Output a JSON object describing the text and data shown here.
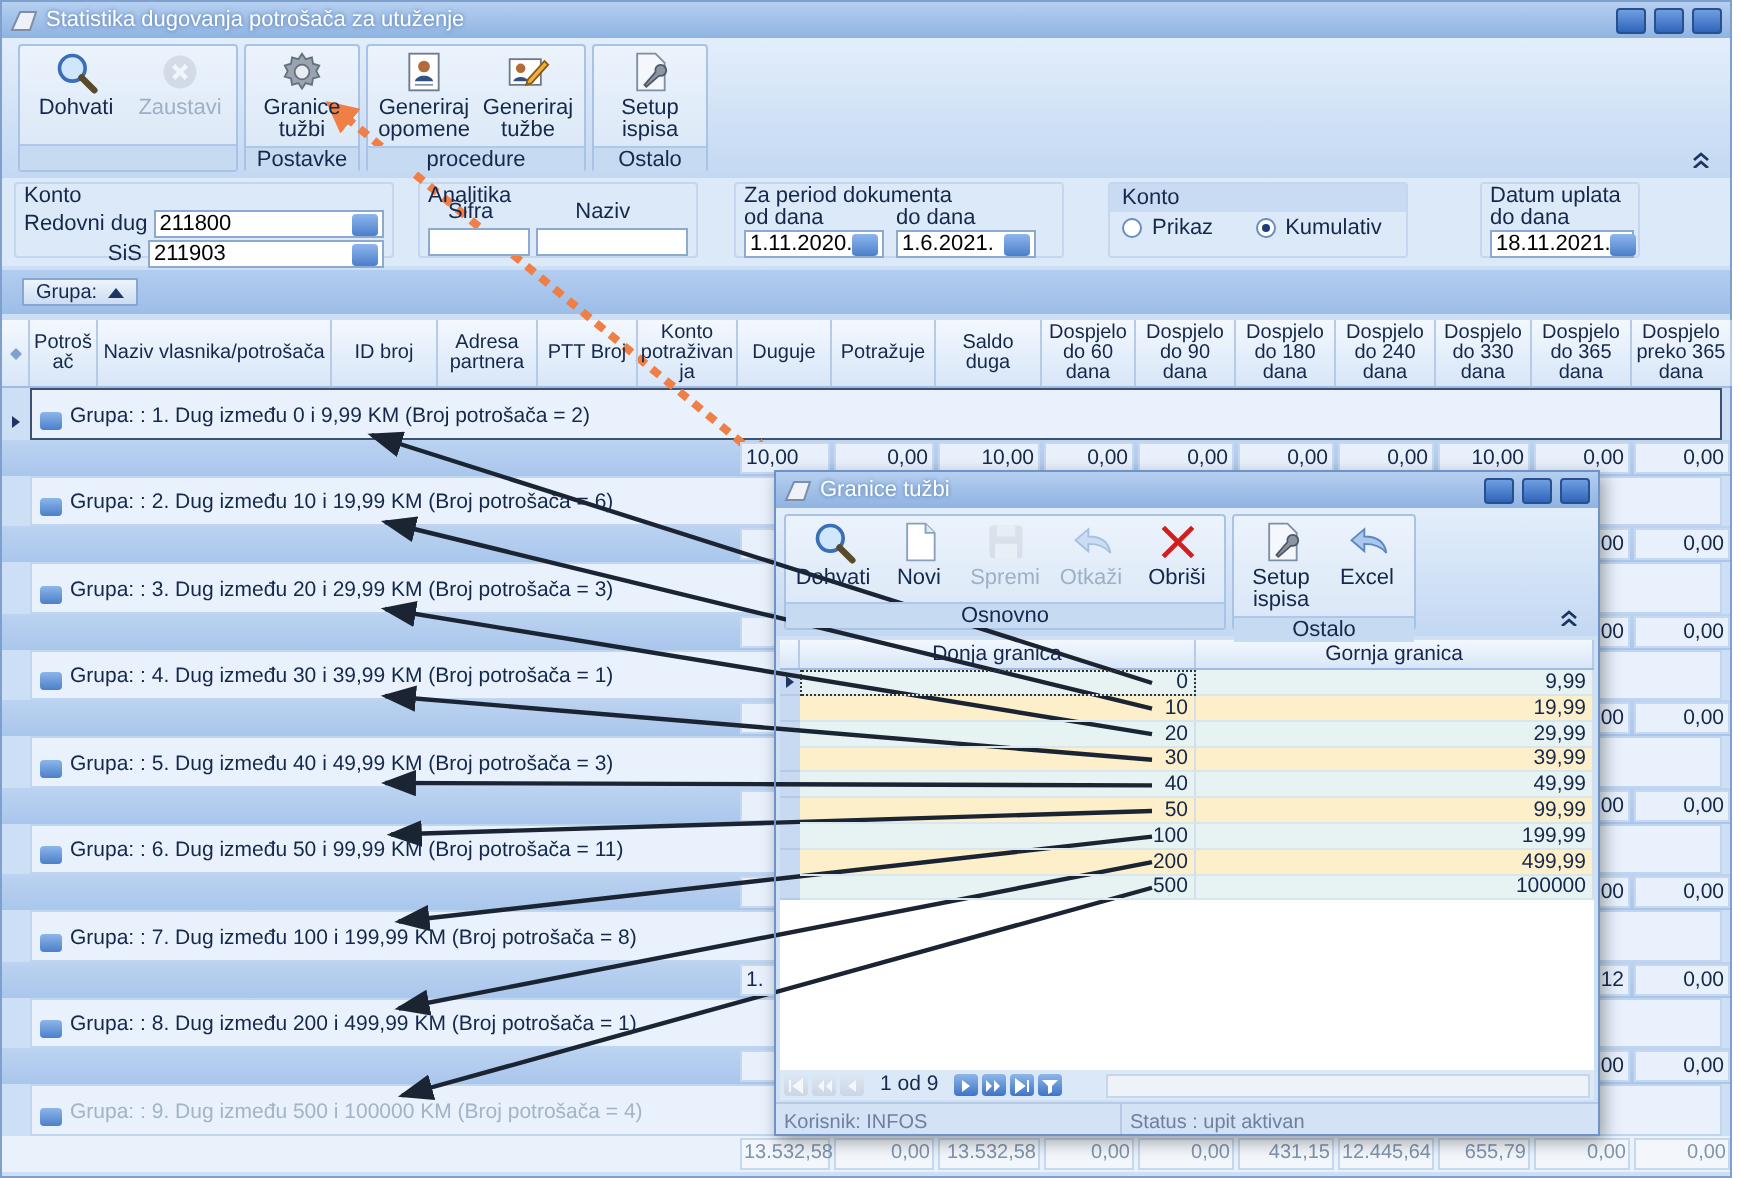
{
  "window": {
    "title": "Statistika dugovanja potrošača za utuženje"
  },
  "ribbon": {
    "groups": [
      {
        "buttons": [
          {
            "label": "Dohvati",
            "kind": "search",
            "disabled": false
          },
          {
            "label": "Zaustavi",
            "kind": "stop",
            "disabled": true
          }
        ]
      },
      {
        "label": "Postavke",
        "buttons": [
          {
            "label": "Granice tužbi",
            "kind": "gear",
            "disabled": false,
            "callout": true
          }
        ]
      },
      {
        "label": "procedure",
        "buttons": [
          {
            "label": "Generiraj opomene",
            "kind": "card",
            "disabled": false
          },
          {
            "label": "Generiraj tužbe",
            "kind": "cardpen",
            "disabled": false
          }
        ]
      },
      {
        "label": "Ostalo",
        "buttons": [
          {
            "label": "Setup ispisa",
            "kind": "setup",
            "disabled": false
          }
        ]
      }
    ]
  },
  "filters": {
    "konto": {
      "title": "Konto",
      "fields": [
        {
          "label": "Redovni dug",
          "value": "211800"
        },
        {
          "label": "SiS",
          "value": "211903"
        }
      ]
    },
    "analitika": {
      "title": "Analitika",
      "columns": [
        "Šifra",
        "Naziv"
      ]
    },
    "period": {
      "title": "Za period dokumenta",
      "fields": [
        {
          "label": "od dana",
          "value": "1.11.2020."
        },
        {
          "label": "do dana",
          "value": "1.6.2021."
        }
      ]
    },
    "konto_view": {
      "title": "Konto",
      "options": [
        {
          "label": "Prikaz",
          "selected": false
        },
        {
          "label": "Kumulativ",
          "selected": true
        }
      ]
    },
    "uplata": {
      "title": "Datum uplata",
      "fields": [
        {
          "label": "do dana",
          "value": "18.11.2021."
        }
      ]
    }
  },
  "group_bar": {
    "label": "Grupa:"
  },
  "grid": {
    "columns": [
      "Potrošač",
      "Naziv vlasnika/potrošača",
      "ID broj",
      "Adresa partnera",
      "PTT Broj",
      "Konto potraživanja",
      "Duguje",
      "Potražuje",
      "Saldo duga",
      "Dospjelo do 60 dana",
      "Dospjelo do 90 dana",
      "Dospjelo do 180 dana",
      "Dospjelo do 240 dana",
      "Dospjelo do 330 dana",
      "Dospjelo do 365 dana",
      "Dospjelo preko 365 dana"
    ],
    "groups": [
      {
        "label": "Grupa: : 1. Dug između 0 i 9,99 KM (Broj potrošača = 2)",
        "current": true,
        "summary": {
          "duguje": "10,00",
          "potrazuje": "0,00",
          "saldo": "10,00",
          "do_60": "0,00",
          "do_90": "0,00",
          "do_180": "0,00",
          "do_240": "0,00",
          "do_330": "10,00",
          "do_365": "0,00",
          "preko_365": "0,00"
        }
      },
      {
        "label": "Grupa: : 2. Dug između 10 i 19,99 KM (Broj potrošača = 6)",
        "current": false,
        "summary": {
          "do_365": "00",
          "preko_365": "0,00"
        }
      },
      {
        "label": "Grupa: : 3. Dug između 20 i 29,99 KM (Broj potrošača = 3)",
        "current": false,
        "summary": {
          "do_365": "00",
          "preko_365": "0,00"
        }
      },
      {
        "label": "Grupa: : 4. Dug između 30 i 39,99 KM (Broj potrošača = 1)",
        "current": false,
        "summary": {
          "do_365": "00",
          "preko_365": "0,00"
        }
      },
      {
        "label": "Grupa: : 5. Dug između 40 i 49,99 KM (Broj potrošača = 3)",
        "current": false,
        "summary": {
          "do_365": "00",
          "preko_365": "0,00"
        }
      },
      {
        "label": "Grupa: : 6. Dug između 50 i 99,99 KM (Broj potrošača = 11)",
        "current": false,
        "summary": {
          "do_365": "00",
          "preko_365": "0,00"
        }
      },
      {
        "label": "Grupa: : 7. Dug između 100 i 199,99 KM (Broj potrošača = 8)",
        "current": false,
        "summary": {
          "duguje": "1.",
          "do_365": "12",
          "preko_365": "0,00"
        }
      },
      {
        "label": "Grupa: : 8. Dug između 200 i 499,99 KM (Broj potrošača = 1)",
        "current": false,
        "summary": {
          "do_365": "00",
          "preko_365": "0,00"
        }
      },
      {
        "label": "Grupa: : 9. Dug između 500 i 100000 KM (Broj potrošača = 4)",
        "current": false
      }
    ],
    "totals": [
      "13.532,58",
      "0,00",
      "13.532,58",
      "0,00",
      "0,00",
      "431,15",
      "12.445,64",
      "655,79",
      "0,00",
      "0,00"
    ]
  },
  "dialog": {
    "title": "Granice tužbi",
    "ribbon": {
      "groups": [
        {
          "label": "Osnovno",
          "buttons": [
            {
              "label": "Dohvati",
              "kind": "search",
              "disabled": false
            },
            {
              "label": "Novi",
              "kind": "doc",
              "disabled": false
            },
            {
              "label": "Spremi",
              "kind": "floppy",
              "disabled": true
            },
            {
              "label": "Otkaži",
              "kind": "undo",
              "disabled": true
            },
            {
              "label": "Obriši",
              "kind": "delete",
              "disabled": false
            }
          ]
        },
        {
          "label": "Ostalo",
          "buttons": [
            {
              "label": "Setup ispisa",
              "kind": "setup",
              "disabled": false
            },
            {
              "label": "Excel",
              "kind": "undo",
              "disabled": false
            }
          ]
        }
      ]
    },
    "columns": [
      "Donja granica",
      "Gornja granica"
    ],
    "rows": [
      {
        "lower": "0",
        "upper": "9,99",
        "current": true,
        "arrow": true
      },
      {
        "lower": "10",
        "upper": "19,99",
        "current": false,
        "arrow": true
      },
      {
        "lower": "20",
        "upper": "29,99",
        "current": false,
        "arrow": true
      },
      {
        "lower": "30",
        "upper": "39,99",
        "current": false,
        "arrow": true
      },
      {
        "lower": "40",
        "upper": "49,99",
        "current": false,
        "arrow": true
      },
      {
        "lower": "50",
        "upper": "99,99",
        "current": false,
        "arrow": true
      },
      {
        "lower": "100",
        "upper": "199,99",
        "current": false,
        "arrow": true
      },
      {
        "lower": "200",
        "upper": "499,99",
        "current": false,
        "arrow": true
      },
      {
        "lower": "500",
        "upper": "100000",
        "current": false,
        "arrow": true
      }
    ],
    "pager": {
      "text": "1 od 9",
      "buttons": [
        {
          "kind": "first",
          "disabled": true
        },
        {
          "kind": "prevpage",
          "disabled": true
        },
        {
          "kind": "prev",
          "disabled": true
        },
        {
          "kind": "next",
          "disabled": false
        },
        {
          "kind": "nextpage",
          "disabled": false
        },
        {
          "kind": "last",
          "disabled": false
        },
        {
          "kind": "filter",
          "disabled": false
        }
      ]
    },
    "status": [
      "Korisnik: INFOS",
      "Status : upit aktivan"
    ]
  }
}
